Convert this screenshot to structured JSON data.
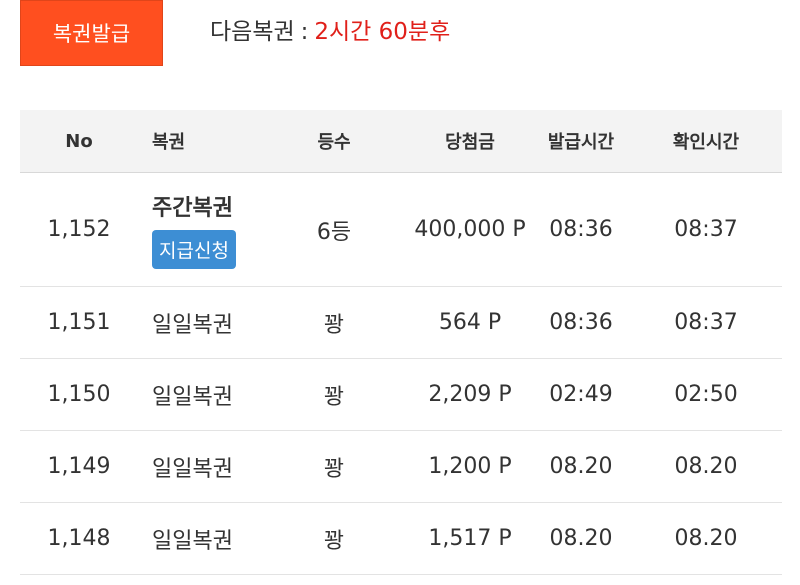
{
  "topbar": {
    "issue_button": "복권발급",
    "next_label": "다음복권",
    "separator": ":",
    "countdown": "2시간 60분후"
  },
  "table": {
    "headers": {
      "no": "No",
      "ticket": "복권",
      "rank": "등수",
      "prize": "당첨금",
      "issued": "발급시간",
      "checked": "확인시간"
    },
    "rows": [
      {
        "no": "1,152",
        "ticket": "주간복권",
        "claim": "지급신청",
        "rank": "6등",
        "prize": "400,000 P",
        "issued": "08:36",
        "checked": "08:37"
      },
      {
        "no": "1,151",
        "ticket": "일일복권",
        "rank": "꽝",
        "prize": "564 P",
        "issued": "08:36",
        "checked": "08:37"
      },
      {
        "no": "1,150",
        "ticket": "일일복권",
        "rank": "꽝",
        "prize": "2,209 P",
        "issued": "02:49",
        "checked": "02:50"
      },
      {
        "no": "1,149",
        "ticket": "일일복권",
        "rank": "꽝",
        "prize": "1,200 P",
        "issued": "08.20",
        "checked": "08.20"
      },
      {
        "no": "1,148",
        "ticket": "일일복권",
        "rank": "꽝",
        "prize": "1,517 P",
        "issued": "08.20",
        "checked": "08.20"
      }
    ]
  },
  "colors": {
    "issue_button_bg": "#ff4f1f",
    "countdown": "#e0201a",
    "claim_button_bg": "#3d8ed4",
    "header_bg": "#f3f3f3"
  }
}
